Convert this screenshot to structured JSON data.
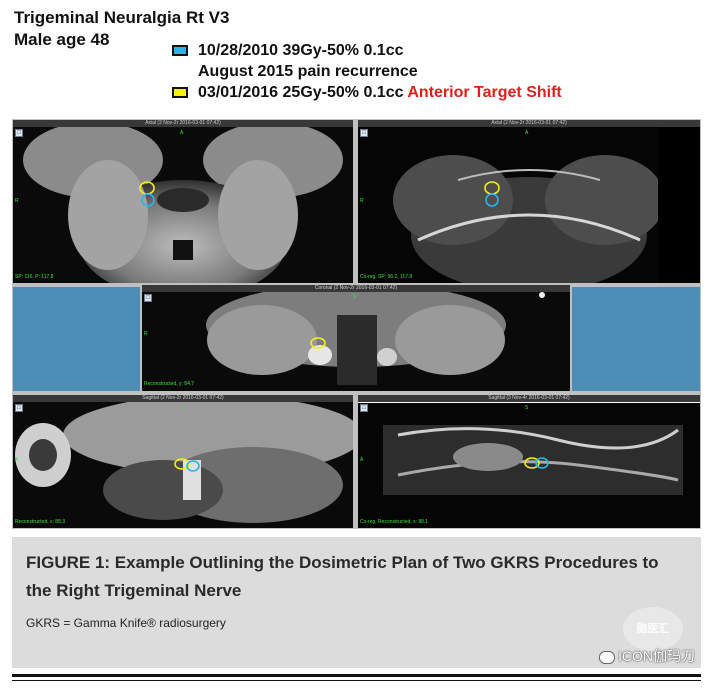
{
  "header": {
    "title": "Trigeminal Neuralgia Rt V3",
    "subtitle": "Male age 48"
  },
  "legend": {
    "items": [
      {
        "color": "#29b5e8",
        "text": "10/28/2010 39Gy-50% 0.1cc"
      },
      {
        "color": "",
        "text": "August 2015 pain recurrence"
      },
      {
        "color": "#f5f00f",
        "text": "03/01/2016 25Gy-50% 0.1cc",
        "highlight": "Anterior Target Shift",
        "highlight_color": "#e0201b"
      }
    ]
  },
  "panes": {
    "axial_t1": {
      "title": "Axial (2 Nov-2r 2016-03-01 07:42)",
      "orient_top": "A",
      "orient_side": "R",
      "footer": "SP: 116, P: 117.8",
      "lock": "□"
    },
    "axial_t2": {
      "title": "Axial (2 Nov-2r 2016-03-01 07:42)",
      "orient_top": "A",
      "orient_side": "R",
      "footer": "Co-reg, SP: 96.2, 117.8",
      "lock": "□"
    },
    "coronal": {
      "title": "Coronal (2 Nov-2r 2016-03-01 07:42)",
      "orient_top": "S",
      "orient_side": "R",
      "footer": "Reconstructed, y: 84.7",
      "lock": "□"
    },
    "sagittal_t1": {
      "title": "Sagittal (2 Nov-2r 2016-03-01 07:42)",
      "orient_top": "S",
      "orient_side": "A",
      "footer": "Reconstructed, x: 88.3",
      "lock": "□"
    },
    "sagittal_t2": {
      "title": "Sagittal (3 Nov-4r 2016-03-01 07:42)",
      "orient_top": "S",
      "orient_side": "A",
      "footer": "Co-reg, Reconstructed, x: 88.1",
      "lock": "□"
    }
  },
  "caption": {
    "figure_title": "FIGURE 1: Example Outlining the Dosimetric Plan of Two GKRS Procedures to the Right Trigeminal Nerve",
    "abbreviation": "GKRS = Gamma Knife® radiosurgery",
    "watermark": "脑医汇"
  },
  "brand": {
    "label": "ICON伽玛刀"
  },
  "colors": {
    "contour_2010": "#29b5e8",
    "contour_2016": "#f5f00f",
    "overlay_text": "#39e33c",
    "side_panel": "#4b8db5"
  }
}
